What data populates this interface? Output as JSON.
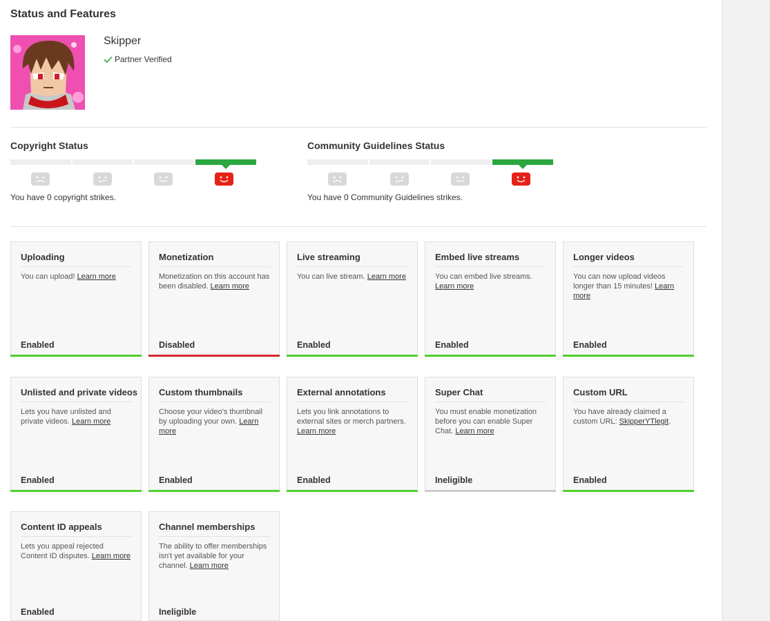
{
  "page": {
    "title": "Status and Features"
  },
  "channel": {
    "name": "Skipper",
    "verified_label": "Partner Verified"
  },
  "copyright": {
    "title": "Copyright Status",
    "strikes_text": "You have 0 copyright strikes.",
    "strikes": 0,
    "levels": 4,
    "active_level": 4
  },
  "community": {
    "title": "Community Guidelines Status",
    "strikes_text": "You have 0 Community Guidelines strikes.",
    "strikes": 0,
    "levels": 4,
    "active_level": 4
  },
  "colors": {
    "enabled": "#4fcf2e",
    "disabled": "#d7262a",
    "ineligible": "#cccccc",
    "status_good": "#2ba640",
    "face_active": "#e62117",
    "face_inactive": "#d8d8d8"
  },
  "features": [
    {
      "title": "Uploading",
      "desc": "You can upload! ",
      "link": "Learn more",
      "desc_after": "",
      "status": "Enabled",
      "state": "enabled"
    },
    {
      "title": "Monetization",
      "desc": "Monetization on this account has been disabled. ",
      "link": "Learn more",
      "desc_after": "",
      "status": "Disabled",
      "state": "disabled"
    },
    {
      "title": "Live streaming",
      "desc": "You can live stream. ",
      "link": "Learn more",
      "desc_after": "",
      "status": "Enabled",
      "state": "enabled"
    },
    {
      "title": "Embed live streams",
      "desc": "You can embed live streams. ",
      "link": "Learn more",
      "desc_after": "",
      "status": "Enabled",
      "state": "enabled"
    },
    {
      "title": "Longer videos",
      "desc": "You can now upload videos longer than 15 minutes! ",
      "link": "Learn more",
      "desc_after": "",
      "status": "Enabled",
      "state": "enabled"
    },
    {
      "title": "Unlisted and private videos",
      "desc": "Lets you have unlisted and private videos. ",
      "link": "Learn more",
      "desc_after": "",
      "status": "Enabled",
      "state": "enabled"
    },
    {
      "title": "Custom thumbnails",
      "desc": "Choose your video's thumbnail by uploading your own. ",
      "link": "Learn more",
      "desc_after": "",
      "status": "Enabled",
      "state": "enabled"
    },
    {
      "title": "External annotations",
      "desc": "Lets you link annotations to external sites or merch partners. ",
      "link": "Learn more",
      "desc_after": "",
      "status": "Enabled",
      "state": "enabled"
    },
    {
      "title": "Super Chat",
      "desc": "You must enable monetization before you can enable Super Chat. ",
      "link": "Learn more",
      "desc_after": "",
      "status": "Ineligible",
      "state": "ineligible"
    },
    {
      "title": "Custom URL",
      "desc": "You have already claimed a custom URL: ",
      "link": "SkipperYTlegit",
      "desc_after": ".",
      "status": "Enabled",
      "state": "enabled"
    },
    {
      "title": "Content ID appeals",
      "desc": "Lets you appeal rejected Content ID disputes. ",
      "link": "Learn more",
      "desc_after": "",
      "status": "Enabled",
      "state": "enabled"
    },
    {
      "title": "Channel memberships",
      "desc": "The ability to offer memberships isn't yet available for your channel. ",
      "link": "Learn more",
      "desc_after": "",
      "status": "Ineligible",
      "state": "ineligible"
    }
  ]
}
